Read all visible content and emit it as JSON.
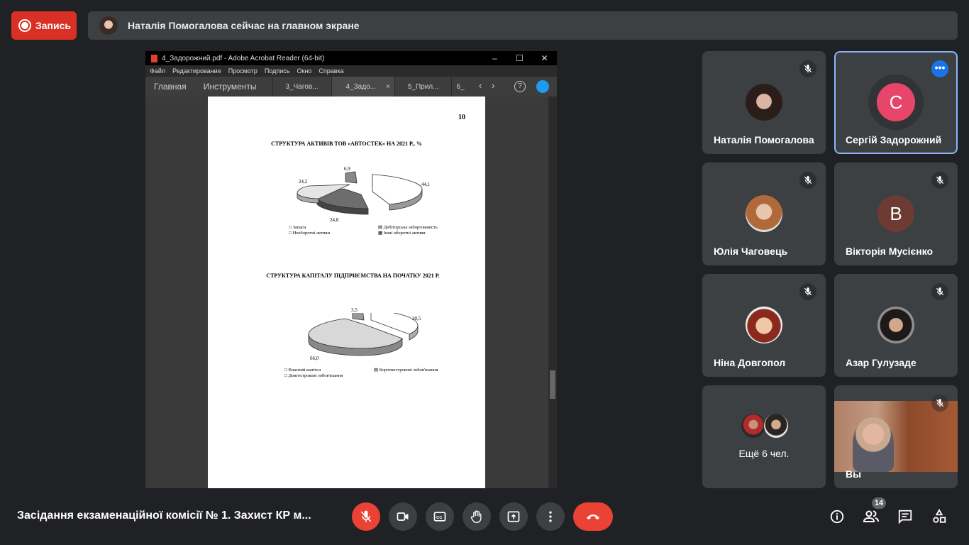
{
  "recording": {
    "label": "Запись"
  },
  "banner": {
    "text": "Наталія Помогалова сейчас на главном экране"
  },
  "acrobat": {
    "window_title": "4_Задорожний.pdf - Adobe Acrobat Reader (64-bit)",
    "menu": [
      "Файл",
      "Редактирование",
      "Просмотр",
      "Подпись",
      "Окно",
      "Справка"
    ],
    "toolbar": {
      "home": "Главная",
      "tools": "Инструменты"
    },
    "tabs": [
      "3_Чагов...",
      "4_Задо...",
      "5_Прил...",
      "6_"
    ],
    "close_tab": "×",
    "help": "?",
    "page": {
      "number": "10",
      "chart1": {
        "title": "СТРУКТУРА АКТИВІВ ТОВ «АВТОСТЕК» НА 2021 Р., %",
        "labels": [
          "6,9",
          "24,2",
          "44,1",
          "24,8"
        ],
        "legend": [
          "Запаси",
          "Дебіторська заборгованість",
          "Необоротні активи",
          "Інші оборотні активи"
        ]
      },
      "chart2": {
        "title": "СТРУКТУРА КАПІТАЛУ ПІДПРИЄМСТВА НА ПОЧАТКУ 2021 Р.",
        "labels": [
          "3,5",
          "30,5",
          "66,0"
        ],
        "legend": [
          "Власний капітал",
          "Короткострокові зобов'язання",
          "Довгострокові зобов'язання"
        ]
      }
    }
  },
  "participants": [
    {
      "name": "Наталія Помогалова",
      "type": "photo",
      "muted": true
    },
    {
      "name": "Сергій Задорожний",
      "type": "letter",
      "letter": "С",
      "color": "#e8456b",
      "active": true
    },
    {
      "name": "Юлія Чаговець",
      "type": "photo",
      "muted": true
    },
    {
      "name": "Вікторія Мусієнко",
      "type": "letter",
      "letter": "В",
      "color": "#6d3b33",
      "muted": true
    },
    {
      "name": "Ніна Довгопол",
      "type": "photo",
      "muted": true
    },
    {
      "name": "Азар Гулузаде",
      "type": "photo",
      "muted": true
    },
    {
      "name": "Ещё 6 чел.",
      "type": "more"
    },
    {
      "name": "Вы",
      "type": "video",
      "muted": true
    }
  ],
  "meeting": {
    "title": "Засідання екзаменаційної комісії № 1. Захист КР м..."
  },
  "people_count": "14"
}
